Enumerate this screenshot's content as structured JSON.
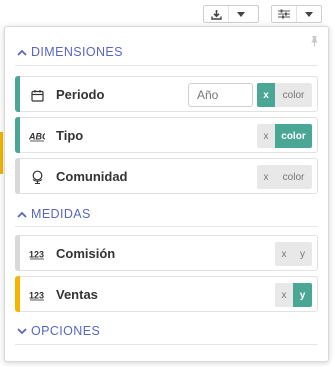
{
  "toolbar": {
    "download_icon": "download-icon",
    "settings_icon": "sliders-icon",
    "dropdown_icon": "caret-down-icon"
  },
  "panel": {
    "pin_icon": "pin-icon",
    "sections": {
      "dimensiones": {
        "label": "DIMENSIONES",
        "state": "expanded"
      },
      "medidas": {
        "label": "MEDIDAS",
        "state": "expanded"
      },
      "opciones": {
        "label": "OPCIONES",
        "state": "collapsed"
      }
    },
    "dimensions": [
      {
        "label": "Periodo",
        "icon": "calendar-icon",
        "field_value": "Año",
        "buttons": [
          "x",
          "color"
        ],
        "active": "x",
        "accent": "#4aa795"
      },
      {
        "label": "Tipo",
        "icon": "abc-icon",
        "buttons": [
          "x",
          "color"
        ],
        "active": "color",
        "accent": "#4aa795"
      },
      {
        "label": "Comunidad",
        "icon": "globe-icon",
        "buttons": [
          "x",
          "color"
        ],
        "active": "",
        "accent": "#d9d9d9"
      }
    ],
    "measures": [
      {
        "label": "Comisión",
        "icon": "number-icon",
        "buttons": [
          "x",
          "y"
        ],
        "active": "",
        "accent": "#d9d9d9"
      },
      {
        "label": "Ventas",
        "icon": "number-icon",
        "buttons": [
          "x",
          "y"
        ],
        "active": "y",
        "accent": "#f5b400"
      }
    ]
  },
  "colors": {
    "accent_teal": "#4aa795",
    "accent_yellow": "#f5b400",
    "section_blue": "#5866c4"
  }
}
